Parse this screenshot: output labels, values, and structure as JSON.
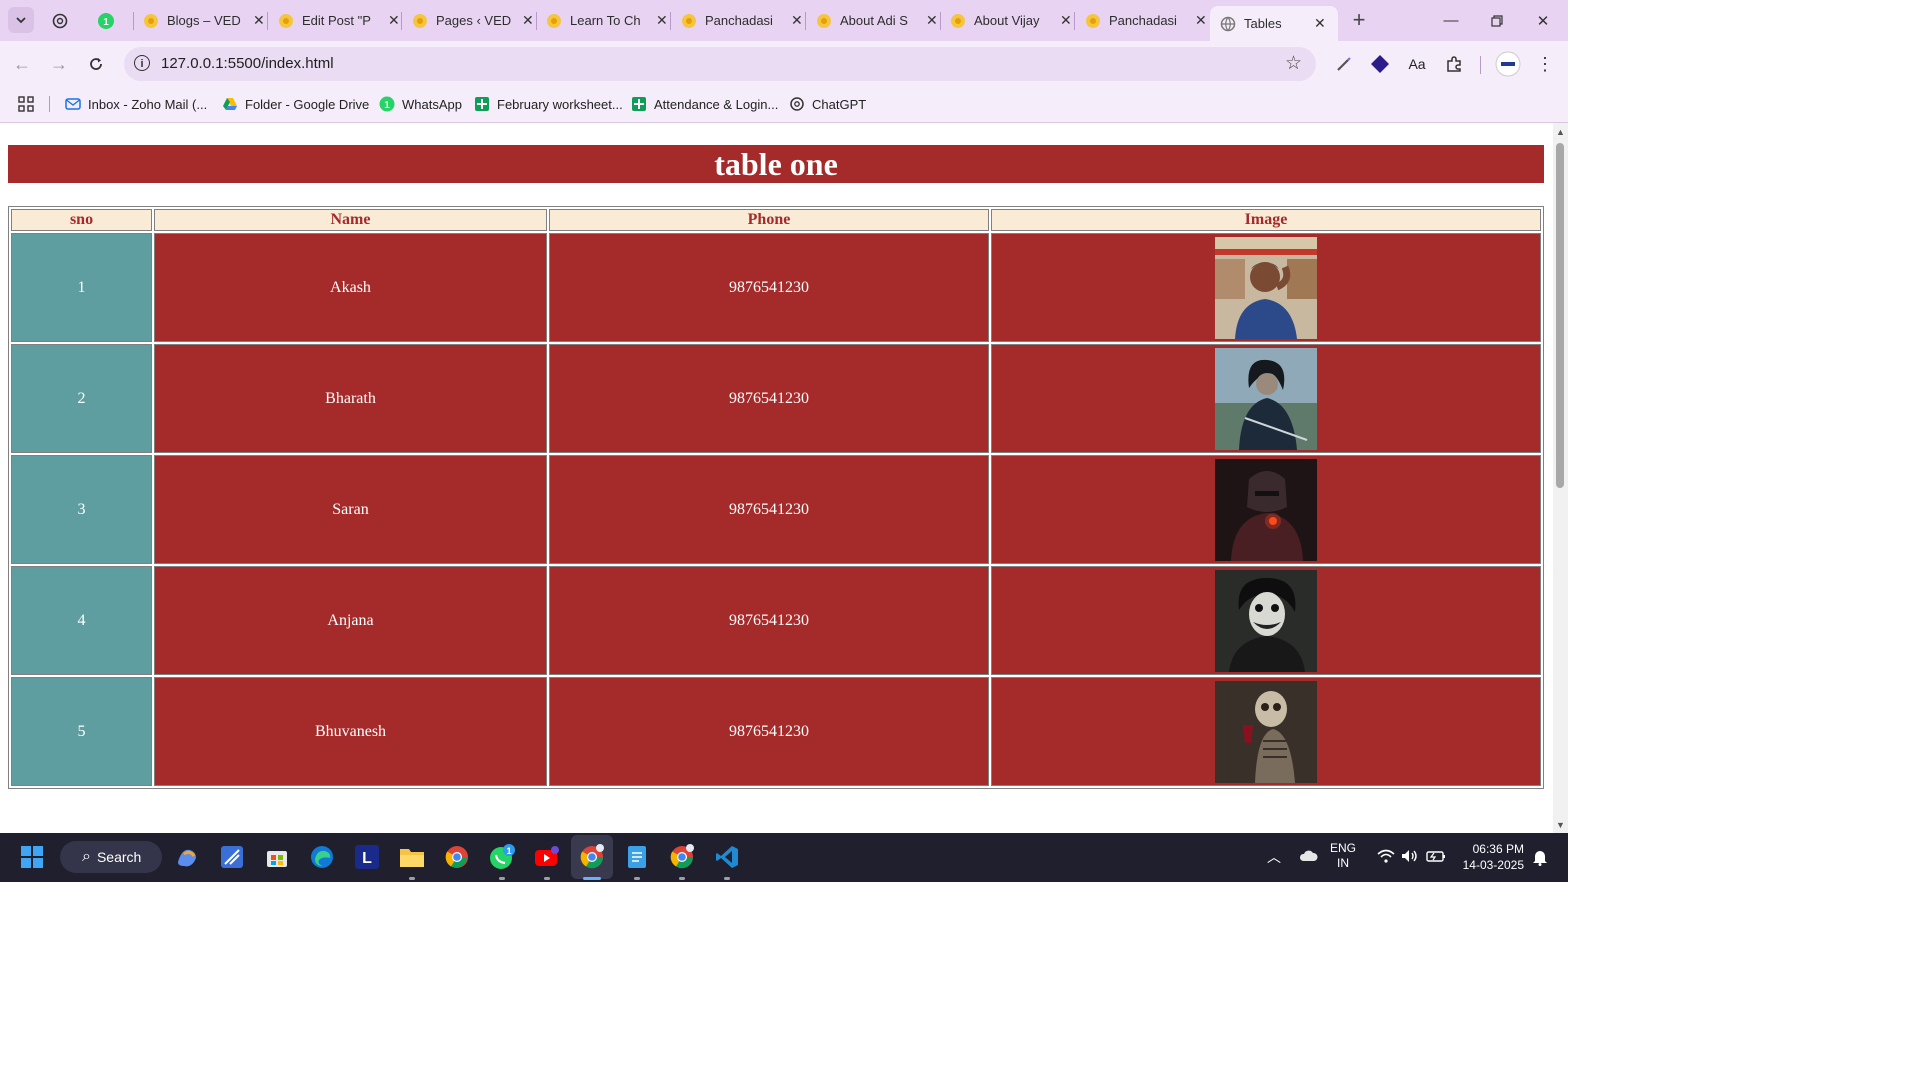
{
  "browser": {
    "tabs": [
      {
        "title": "",
        "favicon": "chatgpt-icon"
      },
      {
        "title": "",
        "favicon": "whatsapp-icon"
      },
      {
        "title": "Blogs – VED",
        "favicon": "wordpress-icon"
      },
      {
        "title": "Edit Post \"P",
        "favicon": "wordpress-icon"
      },
      {
        "title": "Pages ‹ VED",
        "favicon": "wordpress-icon"
      },
      {
        "title": "Learn To Ch",
        "favicon": "wordpress-icon"
      },
      {
        "title": "Panchadasi",
        "favicon": "wordpress-icon"
      },
      {
        "title": "About Adi S",
        "favicon": "wordpress-icon"
      },
      {
        "title": "About Vijay",
        "favicon": "wordpress-icon"
      },
      {
        "title": "Panchadasi",
        "favicon": "wordpress-icon"
      },
      {
        "title": "Tables",
        "favicon": "globe-icon",
        "active": true
      }
    ],
    "url": "127.0.0.1:5500/index.html",
    "bookmarks": [
      {
        "label": "Inbox - Zoho Mail (...",
        "icon": "zoho-mail-icon"
      },
      {
        "label": "Folder - Google Drive",
        "icon": "google-drive-icon"
      },
      {
        "label": "WhatsApp",
        "icon": "whatsapp-icon"
      },
      {
        "label": "February worksheet...",
        "icon": "google-sheets-icon"
      },
      {
        "label": "Attendance & Login...",
        "icon": "google-sheets-icon"
      },
      {
        "label": "ChatGPT",
        "icon": "chatgpt-icon"
      }
    ]
  },
  "page": {
    "heading": "table one",
    "table": {
      "headers": [
        "sno",
        "Name",
        "Phone",
        "Image"
      ],
      "rows": [
        {
          "sno": "1",
          "name": "Akash",
          "phone": "9876541230",
          "image": "man-photo"
        },
        {
          "sno": "2",
          "name": "Bharath",
          "phone": "9876541230",
          "image": "samurai-art"
        },
        {
          "sno": "3",
          "name": "Saran",
          "phone": "9876541230",
          "image": "armored-knight-art"
        },
        {
          "sno": "4",
          "name": "Anjana",
          "phone": "9876541230",
          "image": "joker-art"
        },
        {
          "sno": "5",
          "name": "Bhuvanesh",
          "phone": "9876541230",
          "image": "skeleton-art"
        }
      ]
    },
    "colors": {
      "heading_bg": "#a52a2a",
      "header_bg": "#faebd7",
      "sno_bg": "#5f9ea0",
      "cell_bg": "#a52a2a"
    }
  },
  "taskbar": {
    "search_label": "Search",
    "whatsapp_badge": "1",
    "language": "ENG",
    "region": "IN",
    "time": "06:36 PM",
    "date": "14-03-2025"
  }
}
